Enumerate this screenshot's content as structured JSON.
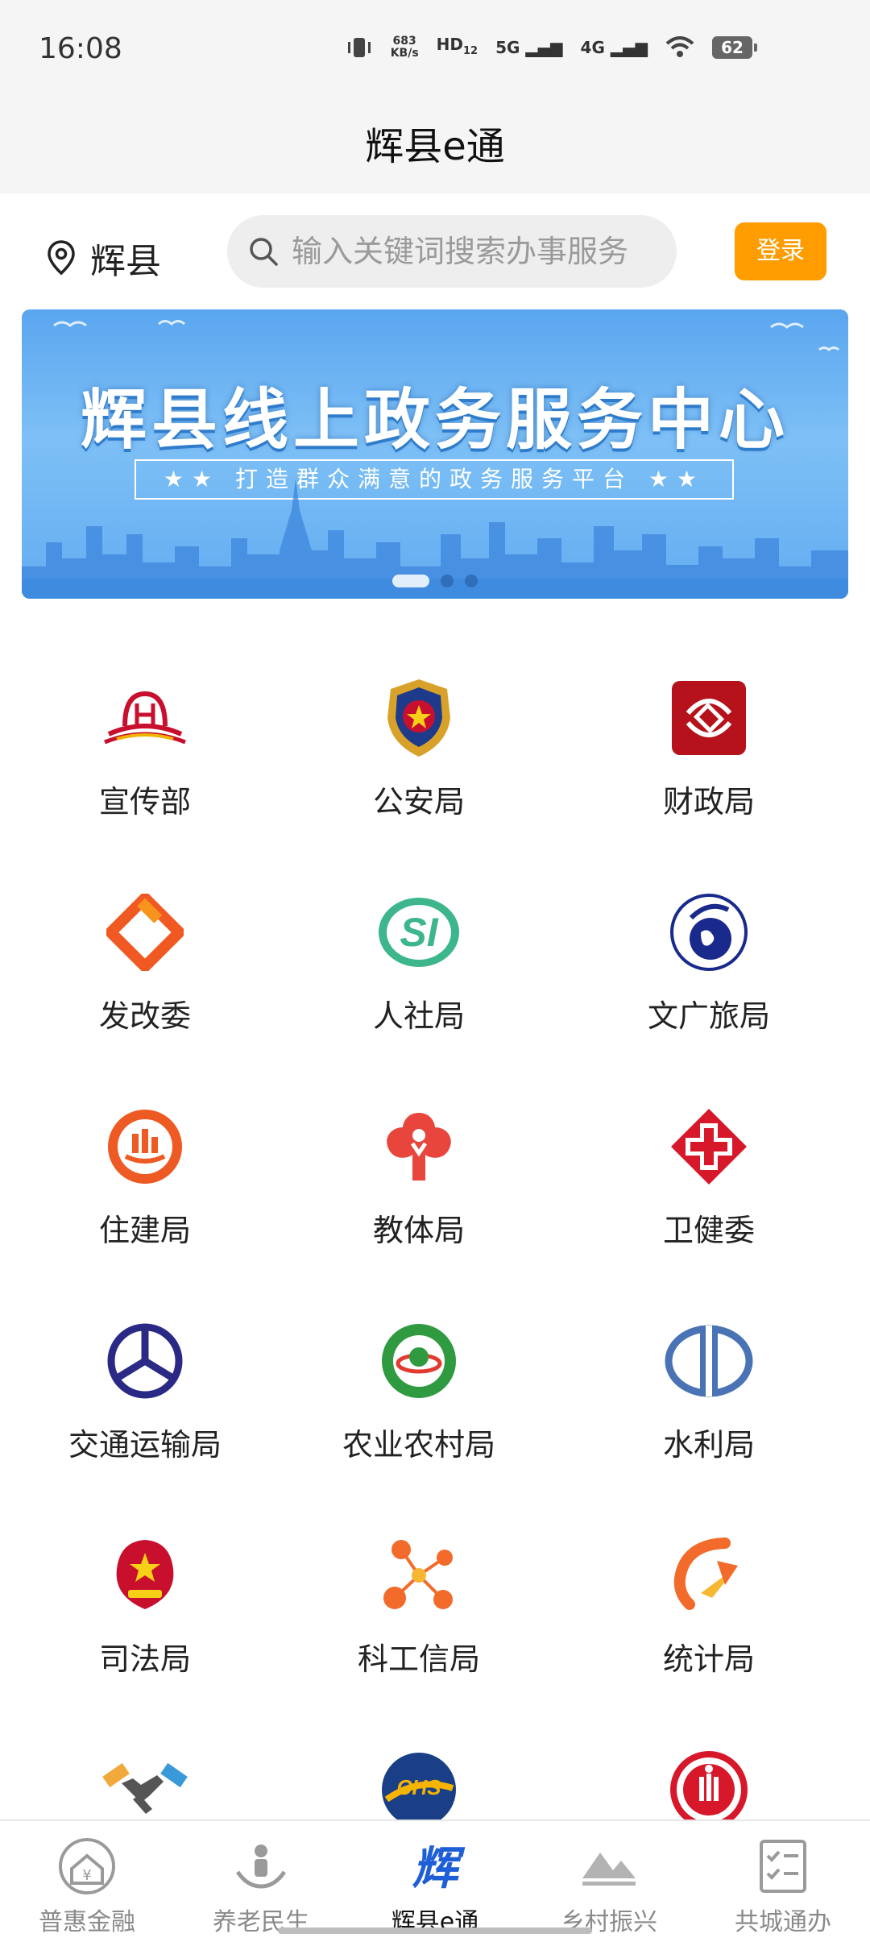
{
  "status": {
    "time": "16:08",
    "net_speed_value": "683",
    "net_speed_unit": "KB/s",
    "hd": "HD",
    "hd_num": "12",
    "sig1": "5G",
    "sig2": "4G",
    "battery": "62"
  },
  "header": {
    "title": "辉县e通"
  },
  "location": {
    "name": "辉县"
  },
  "search": {
    "placeholder": "输入关键词搜索办事服务"
  },
  "login_label": "登录",
  "banner": {
    "title": "辉县线上政务服务中心",
    "subtitle": "★★ 打造群众满意的政务服务平台 ★★",
    "slides": 3,
    "active_slide": 1
  },
  "departments": [
    [
      "宣传部",
      "公安局",
      "财政局"
    ],
    [
      "发改委",
      "人社局",
      "文广旅局"
    ],
    [
      "住建局",
      "教体局",
      "卫健委"
    ],
    [
      "交通运输局",
      "农业农村局",
      "水利局"
    ],
    [
      "司法局",
      "科工信局",
      "统计局"
    ],
    [
      "",
      "",
      ""
    ]
  ],
  "colors": {
    "accent": "#ff9c00",
    "banner_blue": "#5aa6ef",
    "nav_active": "#1e5ed6"
  },
  "nav": [
    {
      "label": "普惠金融",
      "icon": "finance-icon"
    },
    {
      "label": "养老民生",
      "icon": "elderly-icon"
    },
    {
      "label": "辉县e通",
      "icon": "hui-logo-icon",
      "active": true
    },
    {
      "label": "乡村振兴",
      "icon": "mountain-icon"
    },
    {
      "label": "共城通办",
      "icon": "checklist-icon"
    }
  ]
}
